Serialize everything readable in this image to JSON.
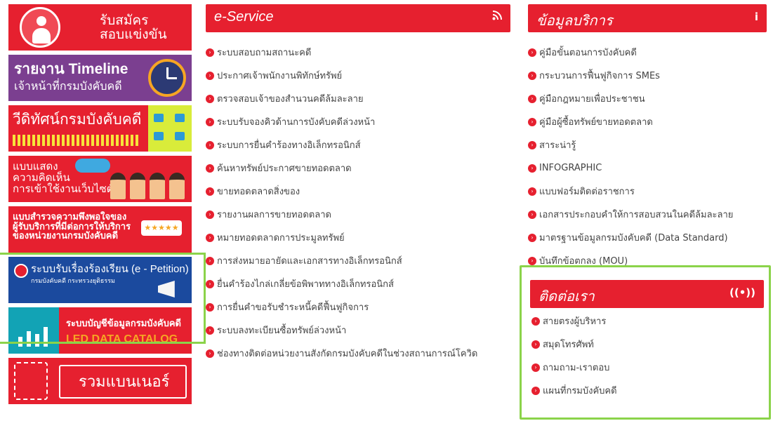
{
  "banners": [
    {
      "line1": "รับสมัคร",
      "line2": "สอบแข่งขัน"
    },
    {
      "line1": "รายงาน Timeline",
      "line2": "เจ้าหน้าที่กรมบังคับคดี"
    },
    {
      "line1": "วีดิทัศน์กรมบังคับคดี"
    },
    {
      "line1": "แบบแสดง",
      "line2": "ความคิดเห็น",
      "line3": "การเข้าใช้งานเว็บไซต์"
    },
    {
      "line1": "แบบสำรวจความพึงพอใจของ",
      "line2": "ผู้รับบริการที่มีต่อการให้บริการ",
      "line3": "ของหน่วยงานกรมบังคับคดี",
      "stars": "★★★★★"
    },
    {
      "line1": "ระบบรับเรื่องร้องเรียน (e - Petition)",
      "line2": "กรมบังคับคดี กระทรวงยุติธรรม"
    },
    {
      "line1": "ระบบบัญชีข้อมูลกรมบังคับคดี",
      "line2": "LED DATA CATALOG"
    },
    {
      "line1": "รวมแบนเนอร์"
    }
  ],
  "eservice": {
    "title": "e-Service",
    "icon": "rss-icon",
    "items": [
      "ระบบสอบถามสถานะคดี",
      "ประกาศเจ้าพนักงานพิทักษ์ทรัพย์",
      "ตรวจสอบเจ้าของสำนวนคดีล้มละลาย",
      "ระบบรับจองคิวด้านการบังคับคดีล่วงหน้า",
      "ระบบการยื่นคำร้องทางอิเล็กทรอนิกส์",
      "ค้นหาทรัพย์ประกาศขายทอดตลาด",
      "ขายทอดตลาดสิ่งของ",
      "รายงานผลการขายทอดตลาด",
      "หมายทอดตลาดการประมูลทรัพย์",
      "การส่งหมายอายัดและเอกสารทางอิเล็กทรอนิกส์",
      "ยื่นคำร้องไกล่เกลี่ยข้อพิพาททางอิเล็กทรอนิกส์",
      "การยื่นคำขอรับชำระหนี้คดีฟื้นฟูกิจการ",
      "ระบบลงทะเบียนซื้อทรัพย์ล่วงหน้า",
      "ช่องทางติดต่อหน่วยงานสังกัดกรมบังคับคดีในช่วงสถานการณ์โควิด"
    ]
  },
  "info": {
    "title": "ข้อมูลบริการ",
    "icon_glyph": "i",
    "items": [
      "คู่มือขั้นตอนการบังคับคดี",
      "กระบวนการฟื้นฟูกิจการ SMEs",
      "คู่มือกฎหมายเพื่อประชาชน",
      "คู่มือผู้ซื้อทรัพย์ขายทอดตลาด",
      "สาระน่ารู้",
      "INFOGRAPHIC",
      "แบบฟอร์มติดต่อราชการ",
      "เอกสารประกอบคำให้การสอบสวนในคดีล้มละลาย",
      "มาตรฐานข้อมูลกรมบังคับคดี (Data Standard)",
      "บันทึกข้อตกลง (MOU)"
    ]
  },
  "contact": {
    "title": "ติดต่อเรา",
    "icon_glyph": "((•))",
    "items": [
      "สายตรงผู้บริหาร",
      "สมุดโทรศัพท์",
      "ถามถาม-เราตอบ",
      "แผนที่กรมบังคับคดี"
    ]
  },
  "colors": {
    "accent": "#e6202f",
    "highlight": "#8bd34a"
  }
}
